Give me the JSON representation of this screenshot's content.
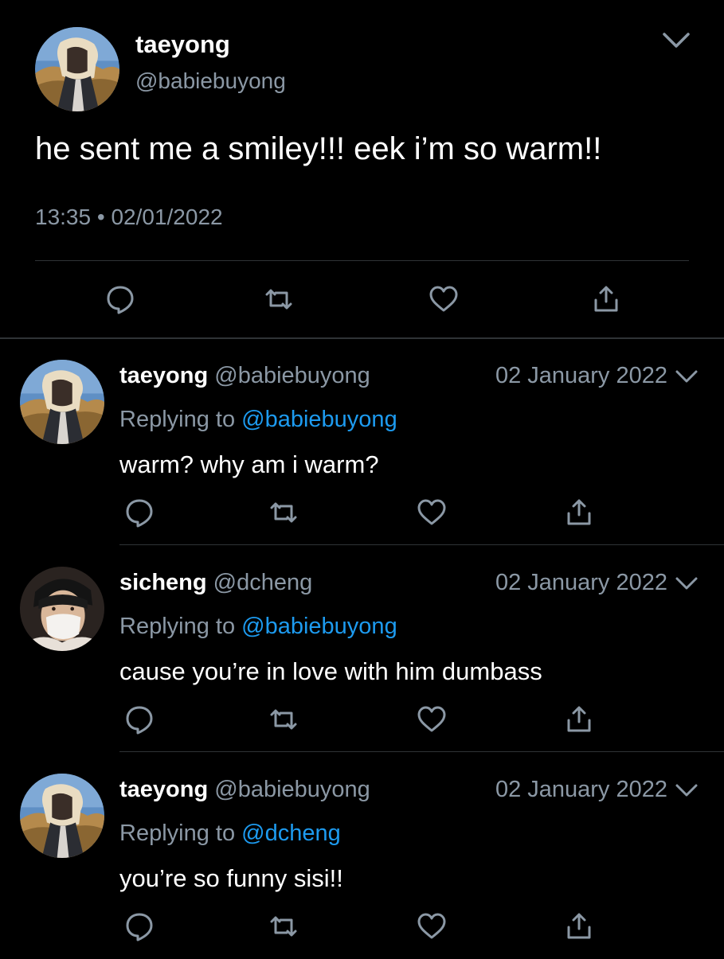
{
  "main_tweet": {
    "name": "taeyong",
    "handle": "@babiebuyong",
    "text": "he sent me a smiley!!! eek i’m so warm!!",
    "time": "13:35",
    "separator": "•",
    "date": "02/01/2022",
    "avatar_icon": "profile-photo-taeyong"
  },
  "replies": [
    {
      "name": "taeyong",
      "handle": "@babiebuyong",
      "date": "02 January 2022",
      "replying_prefix": "Replying to",
      "replying_to": "@babiebuyong",
      "text": "warm? why am i warm?",
      "avatar_icon": "profile-photo-taeyong"
    },
    {
      "name": "sicheng",
      "handle": "@dcheng",
      "date": "02 January 2022",
      "replying_prefix": "Replying to",
      "replying_to": "@babiebuyong",
      "text": "cause you’re in love with him dumbass",
      "avatar_icon": "profile-photo-sicheng"
    },
    {
      "name": "taeyong",
      "handle": "@babiebuyong",
      "date": "02 January 2022",
      "replying_prefix": "Replying to",
      "replying_to": "@dcheng",
      "text": "you’re so funny sisi!!",
      "avatar_icon": "profile-photo-taeyong"
    }
  ],
  "actions": [
    "reply-icon",
    "retweet-icon",
    "like-icon",
    "share-icon"
  ],
  "colors": {
    "background": "#000000",
    "text": "#ffffff",
    "muted": "#8b98a5",
    "link": "#1d9bf0",
    "divider": "#2f3336"
  }
}
